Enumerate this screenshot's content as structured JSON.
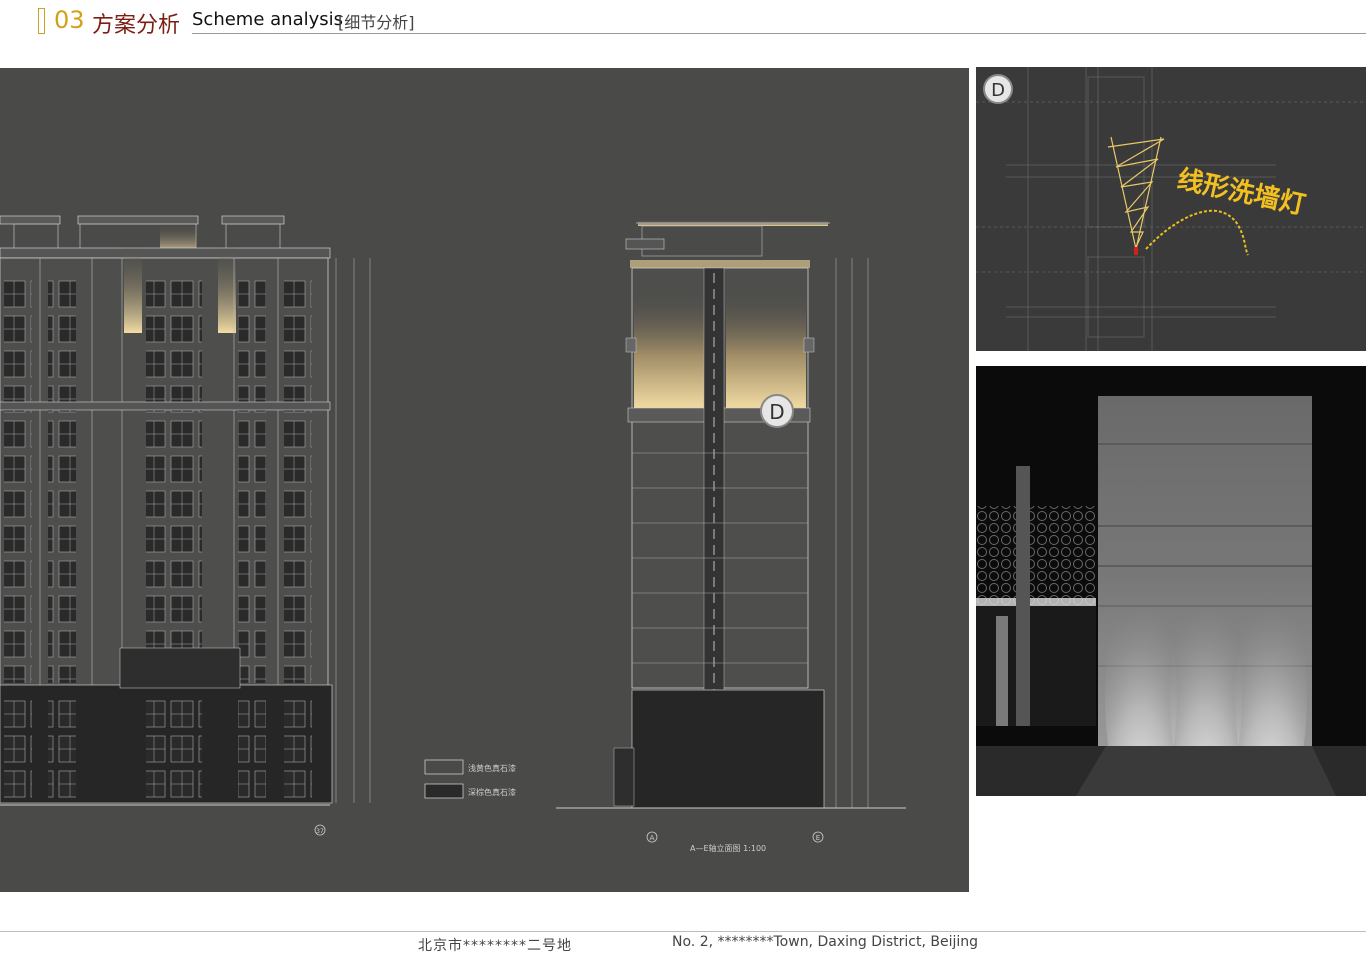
{
  "header": {
    "number": "03",
    "title_cn": "方案分析",
    "title_en": "Scheme analysis",
    "subtitle": "[细节分析]"
  },
  "elevation": {
    "legend": [
      {
        "swatch": "#4a4a48",
        "label": "浅黄色真石漆"
      },
      {
        "swatch": "#2a2a2a",
        "label": "深棕色真石漆"
      }
    ],
    "marker_label": "D",
    "scale_caption": "A—E轴立面图 1:100",
    "grid_labels": [
      "A",
      "E",
      "37"
    ]
  },
  "detail": {
    "marker_label": "D",
    "callout": "线形洗墙灯"
  },
  "footer": {
    "location_cn": "北京市********二号地",
    "location_en": "No. 2, ********Town, Daxing District, Beijing"
  },
  "colors": {
    "accent_gold": "#d4a017",
    "title_red": "#7a1f12",
    "drawing_bg": "#4a4a48",
    "wash_light": "#f0d9a0"
  }
}
